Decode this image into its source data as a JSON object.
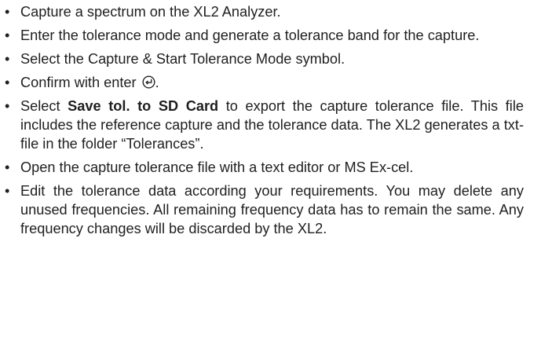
{
  "bullet_glyph": "•",
  "steps": [
    {
      "text": "Capture a spectrum on the XL2 Analyzer."
    },
    {
      "text": "Enter the tolerance mode and generate a tolerance band for the capture."
    },
    {
      "text": "Select the Capture & Start Tolerance Mode symbol."
    },
    {
      "before": "Confirm with enter",
      "icon": "enter-icon",
      "after": "."
    },
    {
      "before": "Select ",
      "bold": "Save tol. to SD Card",
      "after": " to export the capture tolerance file. This file includes the reference capture and the tolerance data. The XL2 generates a txt-file in the folder “Tolerances”."
    },
    {
      "text": "Open the capture tolerance file with a text editor or MS Ex-cel."
    },
    {
      "text": "Edit the tolerance data according your requirements. You may delete any unused frequencies. All remaining frequency data has to remain the same. Any frequency changes will be discarded by the XL2."
    }
  ]
}
